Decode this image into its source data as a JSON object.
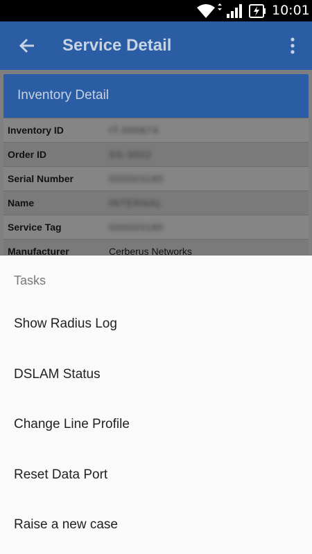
{
  "status_bar": {
    "time": "10:01",
    "icons": [
      "wifi-icon",
      "signal-icon",
      "battery-charging-icon"
    ]
  },
  "app_bar": {
    "title": "Service Detail",
    "back_icon": "arrow-back-icon",
    "menu_icon": "more-vert-icon",
    "color": "#2a5da4"
  },
  "card": {
    "header": "Inventory Detail",
    "rows": [
      {
        "label": "Inventory ID",
        "value": "IT-000674"
      },
      {
        "label": "Order ID",
        "value": "SS-3002"
      },
      {
        "label": "Serial Number",
        "value": "000003180"
      },
      {
        "label": "Name",
        "value": "INTERNAL"
      },
      {
        "label": "Service Tag",
        "value": "000003180"
      },
      {
        "label": "Manufacturer",
        "value": "Cerberus Networks"
      }
    ]
  },
  "sheet": {
    "title": "Tasks",
    "items": [
      "Show Radius Log",
      "DSLAM Status",
      "Change Line Profile",
      "Reset Data Port",
      "Raise a new case"
    ]
  }
}
